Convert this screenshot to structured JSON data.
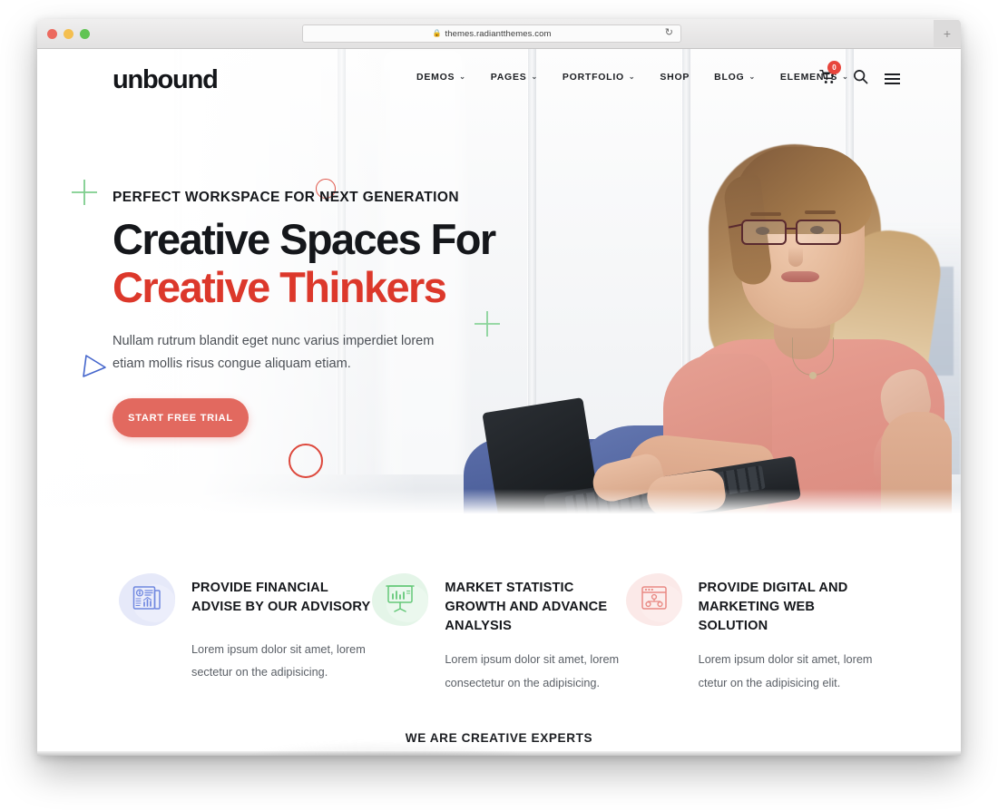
{
  "browser": {
    "url": "themes.radiantthemes.com",
    "lock_icon": "lock-icon",
    "reload_icon": "reload-icon",
    "new_tab_label": "+",
    "traffic_lights": [
      "close",
      "minimize",
      "maximize"
    ]
  },
  "header": {
    "logo": "unbound",
    "nav": [
      {
        "label": "DEMOS",
        "has_dropdown": true
      },
      {
        "label": "PAGES",
        "has_dropdown": true
      },
      {
        "label": "PORTFOLIO",
        "has_dropdown": true
      },
      {
        "label": "SHOP",
        "has_dropdown": false
      },
      {
        "label": "BLOG",
        "has_dropdown": true
      },
      {
        "label": "ELEMENTS",
        "has_dropdown": true
      }
    ],
    "caret_glyph": "⌄",
    "cart": {
      "icon": "cart-icon",
      "count": "0"
    },
    "search": {
      "icon": "search-icon"
    },
    "menu": {
      "icon": "hamburger-menu-icon"
    }
  },
  "hero": {
    "eyebrow": "PERFECT WORKSPACE FOR NEXT GENERATION",
    "title_line1": "Creative Spaces For",
    "title_line2": "Creative Thinkers",
    "description": "Nullam rutrum blandit eget nunc varius imperdiet lorem etiam mollis risus congue aliquam etiam.",
    "cta_label": "START FREE TRIAL",
    "cta_color": "#e2695f",
    "accent_color": "#dc382b",
    "image_alt": "woman-with-laptop-photo"
  },
  "decorations": {
    "plus_green_color": "#7ece8d",
    "circle_red_color": "#dd483c",
    "triangle_blue_color": "#3f63c9"
  },
  "features": [
    {
      "icon": "newspaper-finance-icon",
      "title": "PROVIDE FINANCIAL ADVISE BY OUR ADVISORY",
      "description": "Lorem ipsum dolor sit amet, lorem sectetur on the adipisicing.",
      "color": "#6f87e0",
      "blob_color": "#e6e9f9"
    },
    {
      "icon": "presentation-chart-icon",
      "title": "MARKET STATISTIC GROWTH AND ADVANCE ANALYSIS",
      "description": "Lorem ipsum dolor sit amet, lorem consectetur on the adipisicing.",
      "color": "#64c878",
      "blob_color": "#e4f5e8"
    },
    {
      "icon": "browser-network-icon",
      "title": "PROVIDE DIGITAL AND MARKETING WEB SOLUTION",
      "description": "Lorem ipsum dolor sit amet, lorem ctetur on the adipisicing elit.",
      "color": "#e98a84",
      "blob_color": "#fbe9e8"
    }
  ],
  "bottom": {
    "heading": "WE ARE CREATIVE EXPERTS"
  }
}
